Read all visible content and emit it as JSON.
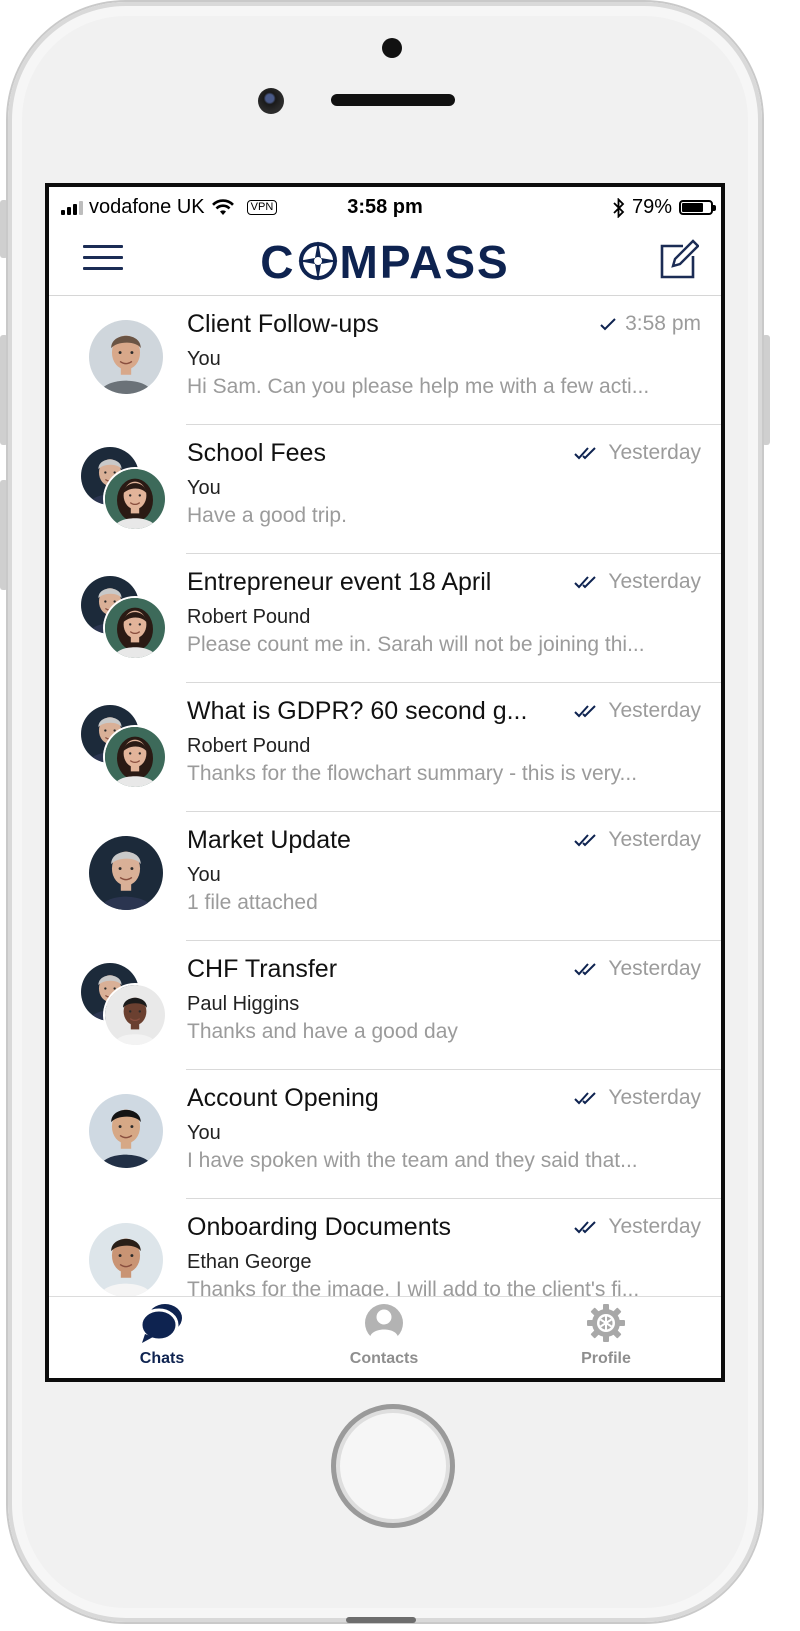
{
  "status_bar": {
    "carrier": "vodafone UK",
    "vpn": "VPN",
    "time": "3:58 pm",
    "battery": "79%",
    "battery_level": 0.79
  },
  "header": {
    "logo_text_left": "C",
    "logo_text_right": "MPASS",
    "menu_icon": "hamburger-icon",
    "compose_icon": "compose-icon"
  },
  "colors": {
    "brand": "#0e2350",
    "muted_text": "#9b9b9b",
    "separator": "#d9d9d9"
  },
  "chats": [
    {
      "title": "Client Follow-ups",
      "sender": "You",
      "preview": "Hi Sam. Can you please help me with a few acti...",
      "time": "3:58 pm",
      "status_icon": "single-check-icon",
      "avatars": [
        "man-grey-shirt"
      ]
    },
    {
      "title": "School Fees",
      "sender": "You",
      "preview": "Have a good trip.",
      "time": "Yesterday",
      "status_icon": "double-check-icon",
      "avatars": [
        "man-silver-hair",
        "woman-dark-hair"
      ]
    },
    {
      "title": "Entrepreneur event 18 April",
      "sender": "Robert Pound",
      "preview": "Please count me in. Sarah will not be joining thi...",
      "time": "Yesterday",
      "status_icon": "double-check-icon",
      "avatars": [
        "man-silver-hair",
        "woman-dark-hair"
      ]
    },
    {
      "title": "What is GDPR? 60 second g...",
      "sender": "Robert Pound",
      "preview": "Thanks for the flowchart summary - this is very...",
      "time": "Yesterday",
      "status_icon": "double-check-icon",
      "avatars": [
        "man-silver-hair",
        "woman-dark-hair"
      ]
    },
    {
      "title": "Market Update",
      "sender": "You",
      "preview": "1 file attached",
      "time": "Yesterday",
      "status_icon": "double-check-icon",
      "avatars": [
        "man-silver-hair"
      ]
    },
    {
      "title": "CHF Transfer",
      "sender": "Paul Higgins",
      "preview": "Thanks and have a good day",
      "time": "Yesterday",
      "status_icon": "double-check-icon",
      "avatars": [
        "man-silver-hair",
        "man-dark-skin"
      ]
    },
    {
      "title": "Account Opening",
      "sender": "You",
      "preview": "I have spoken with the team and they said that...",
      "time": "Yesterday",
      "status_icon": "double-check-icon",
      "avatars": [
        "man-black-hair-suit"
      ]
    },
    {
      "title": "Onboarding Documents",
      "sender": "Ethan George",
      "preview": "Thanks for the image. I will add to the client's fi...",
      "time": "Yesterday",
      "status_icon": "double-check-icon",
      "avatars": [
        "man-smiling"
      ]
    }
  ],
  "tabs": [
    {
      "label": "Chats",
      "icon": "chat-bubbles-icon",
      "active": true
    },
    {
      "label": "Contacts",
      "icon": "person-icon",
      "active": false
    },
    {
      "label": "Profile",
      "icon": "gear-icon",
      "active": false
    }
  ]
}
